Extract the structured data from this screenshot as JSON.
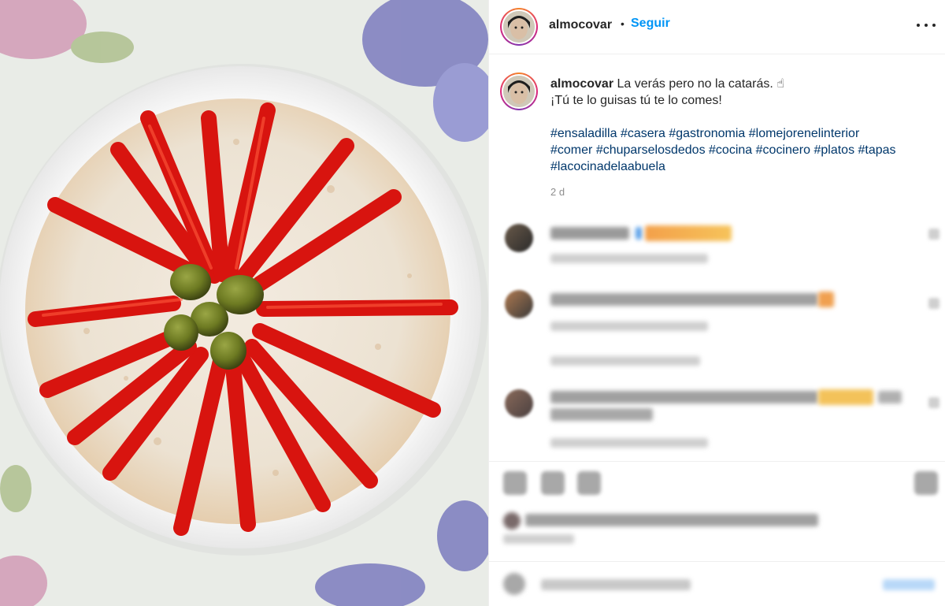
{
  "post": {
    "username": "almocovar",
    "separator": "•",
    "follow_label": "Seguir",
    "more_icon": "more-horizontal-icon",
    "caption": {
      "text_line1": "La verás pero no la catarás. ☝",
      "text_line2": "¡Tú te lo guisas tú te lo comes!",
      "hashtags": [
        "#ensaladilla",
        "#casera",
        "#gastronomia",
        "#lomejorenelinterior",
        "#comer",
        "#chuparselosdedos",
        "#cocina",
        "#cocinero",
        "#platos",
        "#tapas",
        "#lacocinadelaabuela"
      ],
      "time": "2 d"
    },
    "photo_description": "ensaladilla-rusa-plate-with-red-pepper-strips-and-olives"
  },
  "colors": {
    "link_blue": "#0095f6",
    "hashtag": "#00376b",
    "muted": "#8e8e8e",
    "text": "#262626",
    "border": "#efefef"
  }
}
